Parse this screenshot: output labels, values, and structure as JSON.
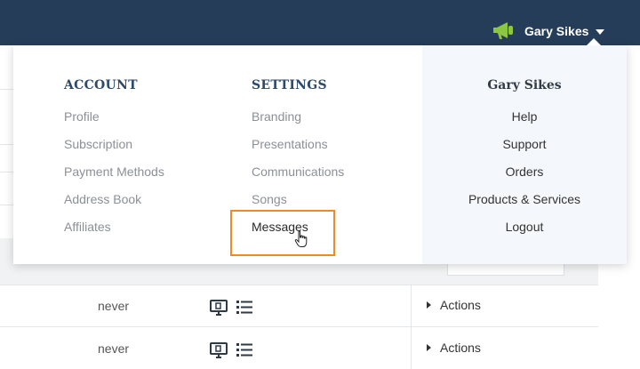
{
  "topbar": {
    "username": "Gary Sikes",
    "accent_color": "#8dc63f",
    "bg_color": "#263d59",
    "notification_icon": "megaphone-icon",
    "caret_icon": "caret-down-icon"
  },
  "dropdown": {
    "account": {
      "title": "ACCOUNT",
      "items": [
        {
          "label": "Profile"
        },
        {
          "label": "Subscription"
        },
        {
          "label": "Payment Methods"
        },
        {
          "label": "Address Book"
        },
        {
          "label": "Affiliates"
        }
      ]
    },
    "settings": {
      "title": "SETTINGS",
      "items": [
        {
          "label": "Branding"
        },
        {
          "label": "Presentations"
        },
        {
          "label": "Communications"
        },
        {
          "label": "Songs"
        },
        {
          "label": "Messages",
          "active": true
        }
      ]
    },
    "user": {
      "title": "Gary Sikes",
      "items": [
        {
          "label": "Help"
        },
        {
          "label": "Support"
        },
        {
          "label": "Orders"
        },
        {
          "label": "Products & Services"
        },
        {
          "label": "Logout"
        }
      ]
    },
    "highlight_color": "#f08a24"
  },
  "table": {
    "rows": [
      {
        "last": "never",
        "actions_label": "Actions",
        "icons": [
          "presentation-icon",
          "list-icon"
        ]
      },
      {
        "last": "never",
        "actions_label": "Actions",
        "icons": [
          "presentation-icon",
          "list-icon"
        ]
      }
    ]
  }
}
